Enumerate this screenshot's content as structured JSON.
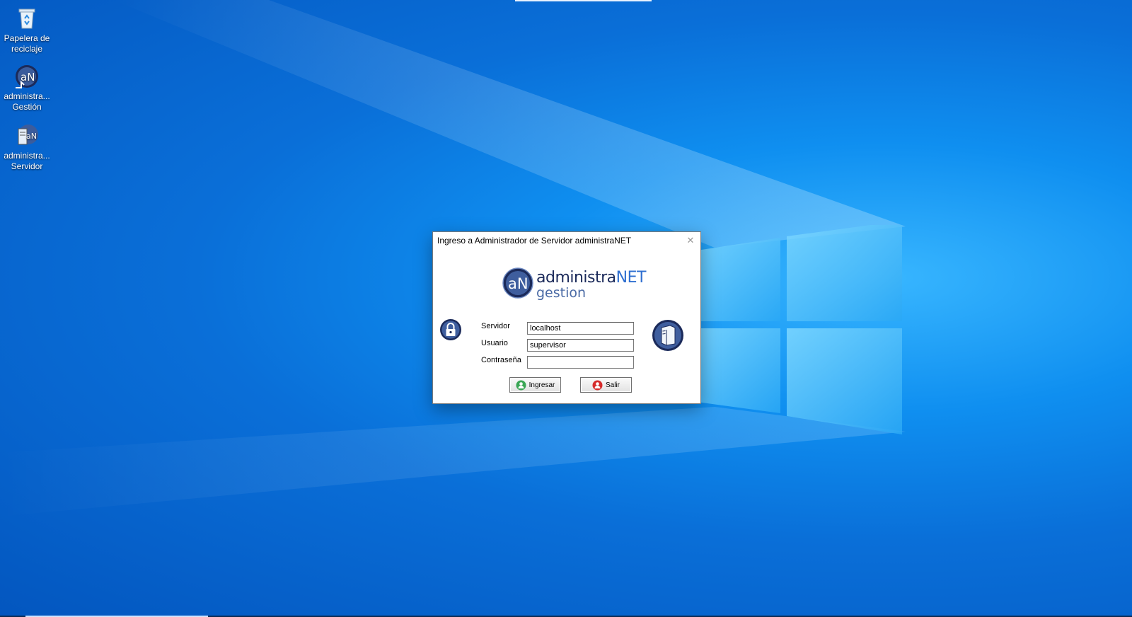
{
  "desktop": {
    "icons": [
      {
        "label": "Papelera de reciclaje",
        "icon": "recycle-bin-icon"
      },
      {
        "label": "administra... Gestión",
        "icon": "administranet-gestion-icon"
      },
      {
        "label": "administra... Servidor",
        "icon": "administranet-servidor-icon"
      }
    ]
  },
  "dialog": {
    "title": "Ingreso a Administrador de Servidor administraNET",
    "close_glyph": "✕",
    "logo": {
      "line1": "administra",
      "line1_accent": "NET",
      "line2": "gestion"
    },
    "fields": [
      {
        "label": "Servidor",
        "value": "localhost"
      },
      {
        "label": "Usuario",
        "value": "supervisor"
      },
      {
        "label": "Contraseña",
        "value": ""
      }
    ],
    "buttons": {
      "login": "Ingresar",
      "exit": "Salir"
    },
    "colors": {
      "accent": "#1b2a5a",
      "brand_blue": "#2f6fd0"
    }
  }
}
